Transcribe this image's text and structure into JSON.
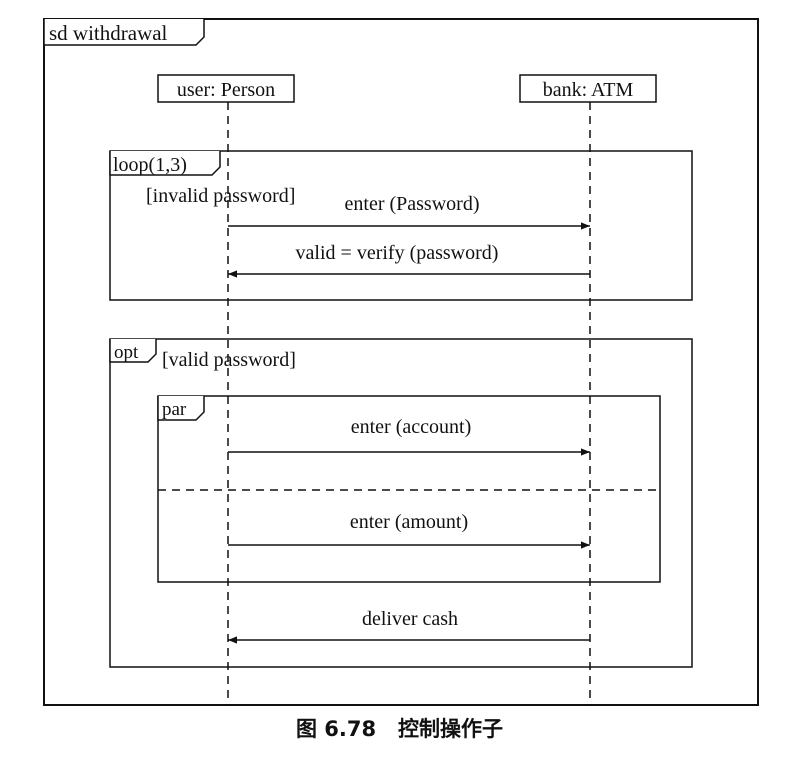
{
  "diagram": {
    "frame_label": "sd withdrawal",
    "lifelines": {
      "user": "user: Person",
      "bank": "bank: ATM"
    },
    "fragments": {
      "loop": {
        "operator": "loop(1,3)",
        "guard": "[invalid password]"
      },
      "opt": {
        "operator": "opt",
        "guard": "[valid password]"
      },
      "par": {
        "operator": "par"
      }
    },
    "messages": [
      {
        "label": "enter (Password)",
        "from": "user",
        "to": "bank"
      },
      {
        "label": "valid = verify (password)",
        "from": "bank",
        "to": "user"
      },
      {
        "label": "enter (account)",
        "from": "user",
        "to": "bank"
      },
      {
        "label": "enter (amount)",
        "from": "user",
        "to": "bank"
      },
      {
        "label": "deliver cash",
        "from": "bank",
        "to": "user"
      }
    ]
  },
  "caption": "图 6.78   控制操作子"
}
